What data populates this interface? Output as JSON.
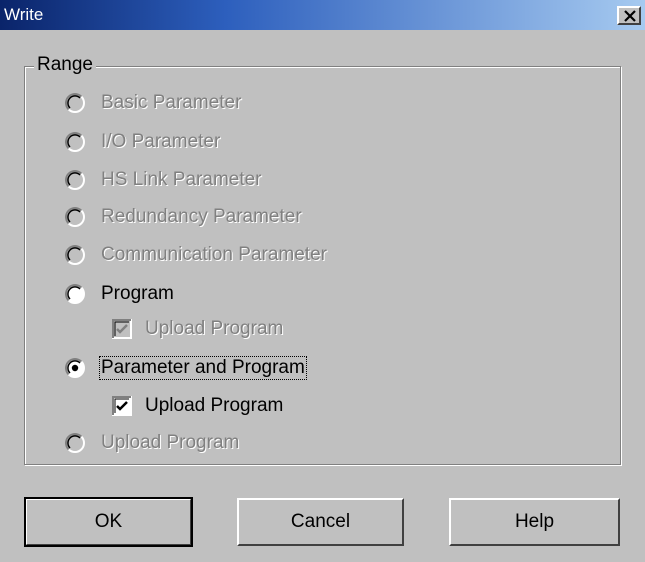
{
  "window": {
    "title": "Write",
    "close_icon": "close-icon"
  },
  "range": {
    "label": "Range",
    "options": [
      {
        "label": "Basic Parameter",
        "enabled": false,
        "selected": false
      },
      {
        "label": "I/O Parameter",
        "enabled": false,
        "selected": false
      },
      {
        "label": "HS Link Parameter",
        "enabled": false,
        "selected": false
      },
      {
        "label": "Redundancy Parameter",
        "enabled": false,
        "selected": false
      },
      {
        "label": "Communication Parameter",
        "enabled": false,
        "selected": false
      },
      {
        "label": "Program",
        "enabled": true,
        "selected": false
      },
      {
        "label": "Parameter and Program",
        "enabled": true,
        "selected": true,
        "focused": true
      },
      {
        "label": "Upload Program",
        "enabled": false,
        "selected": false
      }
    ],
    "program_upload_checkbox": {
      "label": "Upload Program",
      "enabled": false,
      "checked": true
    },
    "param_program_upload_checkbox": {
      "label": "Upload Program",
      "enabled": true,
      "checked": true
    }
  },
  "buttons": {
    "ok": "OK",
    "cancel": "Cancel",
    "help": "Help"
  }
}
